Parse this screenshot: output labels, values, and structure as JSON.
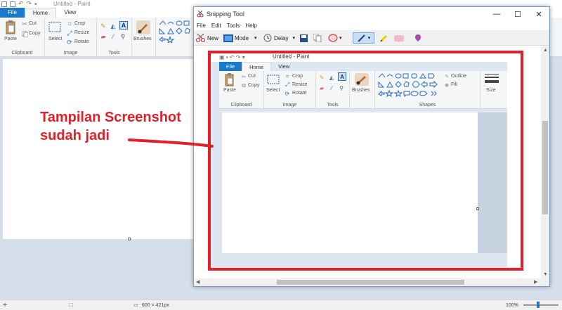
{
  "background_app": {
    "title": "Untitled - Paint",
    "tabs": [
      {
        "label": "File"
      },
      {
        "label": "Home"
      },
      {
        "label": "View"
      }
    ],
    "ribbon": {
      "paste": "Paste",
      "cut": "Cut",
      "copy": "Copy",
      "clipboard": "Clipboard",
      "select": "Select",
      "crop": "Crop",
      "resize": "Resize",
      "rotate": "Rotate",
      "image": "Image",
      "tools": "Tools",
      "brushes": "Brushes"
    },
    "status": {
      "size": "600 × 421px",
      "zoom": "100%"
    }
  },
  "snipping_tool": {
    "title": "Snipping Tool",
    "menu": [
      "File",
      "Edit",
      "Tools",
      "Help"
    ],
    "toolbar": {
      "new": "New",
      "mode": "Mode",
      "delay": "Delay"
    },
    "captured": {
      "title": "Untitled - Paint",
      "tabs": [
        {
          "label": "File"
        },
        {
          "label": "Home"
        },
        {
          "label": "View"
        }
      ],
      "ribbon": {
        "paste": "Paste",
        "cut": "Cut",
        "copy": "Copy",
        "clipboard": "Clipboard",
        "select": "Select",
        "crop": "Crop",
        "resize": "Resize",
        "rotate": "Rotate",
        "image": "Image",
        "tools": "Tools",
        "brushes": "Brushes",
        "outline": "Outline",
        "fill": "Fill",
        "shapes": "Shapes",
        "size": "Size"
      }
    }
  },
  "annotation": {
    "line1": "Tampilan Screenshot",
    "line2": "sudah jadi"
  },
  "colors": {
    "accent": "#1979ca",
    "annotation": "#e0202a"
  }
}
